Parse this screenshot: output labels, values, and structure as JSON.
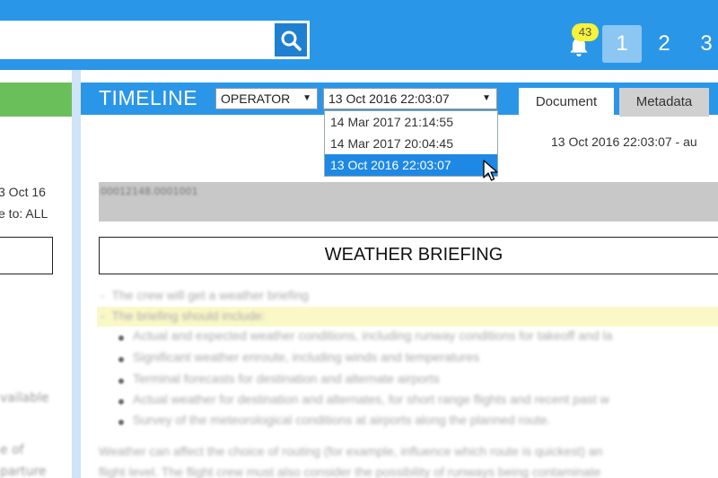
{
  "header": {
    "search": {
      "value": "",
      "placeholder": ""
    },
    "notifications": {
      "count": "43"
    },
    "pages": [
      "1",
      "2",
      "3"
    ],
    "active_page": "1"
  },
  "left_panel": {
    "fragment_date": "3 Oct 16",
    "fragment_visible_to": "e to: ALL",
    "blurred_lines": [
      "vailable",
      "e of",
      "parture"
    ]
  },
  "timeline": {
    "title": "TIMELINE",
    "operator_select": "OPERATOR",
    "date_select": "13 Oct 2016 22:03:07",
    "date_options": [
      "14 Mar 2017 21:14:55",
      "14 Mar 2017 20:04:45",
      "13 Oct 2016 22:03:07"
    ],
    "selected_option": "13 Oct 2016 22:03:07",
    "tabs": [
      "Document",
      "Metadata"
    ],
    "active_tab": "Document"
  },
  "document": {
    "meta_line": "13 Oct 2016 22:03:07 - au",
    "id_text": "00012148.0001001",
    "section_title": "WEATHER BRIEFING",
    "items": [
      "The crew will get a weather briefing",
      "The briefing should include:"
    ],
    "bullets": [
      "Actual and expected weather conditions, including runway conditions for takeoff and la",
      "Significant weather enroute, including winds and temperatures",
      "Terminal forecasts for destination and alternate airports",
      "Actual weather for destination and alternates, for short range flights and recent past w",
      "Survey of the meteorological conditions at airports along the planned route."
    ],
    "paragraph": [
      "Weather can affect the choice of routing (for example, influence which route is quickest) an",
      "flight level. The flight crew must also consider the possibility of runways being contaminate"
    ]
  },
  "colors": {
    "primary": "#2a96e8",
    "badge": "#f7f23a",
    "green": "#6abf5a",
    "selected": "#1e88e5",
    "highlight": "#fbf8c8"
  }
}
